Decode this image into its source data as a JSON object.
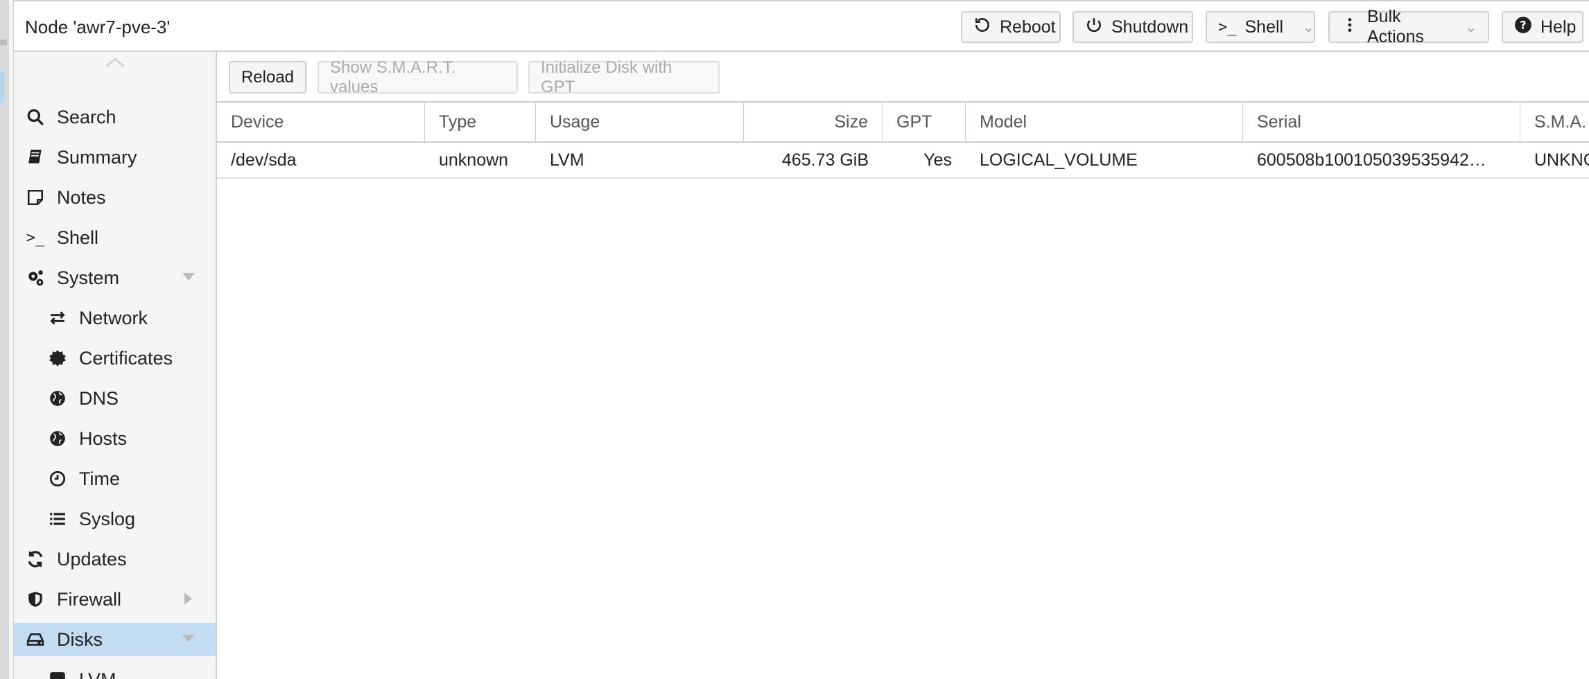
{
  "header": {
    "title": "Node 'awr7-pve-3'",
    "buttons": {
      "reboot": "Reboot",
      "shutdown": "Shutdown",
      "shell": "Shell",
      "bulk_actions": "Bulk Actions",
      "help": "Help"
    }
  },
  "sidebar": {
    "items": [
      {
        "label": "Search",
        "icon": "search-icon"
      },
      {
        "label": "Summary",
        "icon": "book-icon"
      },
      {
        "label": "Notes",
        "icon": "note-icon"
      },
      {
        "label": "Shell",
        "icon": "terminal-icon"
      },
      {
        "label": "System",
        "icon": "gears-icon"
      },
      {
        "label": "Network",
        "icon": "exchange-icon"
      },
      {
        "label": "Certificates",
        "icon": "certificate-icon"
      },
      {
        "label": "DNS",
        "icon": "globe-icon"
      },
      {
        "label": "Hosts",
        "icon": "globe-icon"
      },
      {
        "label": "Time",
        "icon": "clock-icon"
      },
      {
        "label": "Syslog",
        "icon": "list-icon"
      },
      {
        "label": "Updates",
        "icon": "refresh-icon"
      },
      {
        "label": "Firewall",
        "icon": "shield-icon"
      },
      {
        "label": "Disks",
        "icon": "hdd-icon"
      },
      {
        "label": "LVM",
        "icon": "square-icon"
      }
    ]
  },
  "toolbar": {
    "reload": "Reload",
    "smart": "Show S.M.A.R.T. values",
    "init_gpt": "Initialize Disk with GPT"
  },
  "grid": {
    "columns": [
      "Device",
      "Type",
      "Usage",
      "Size",
      "GPT",
      "Model",
      "Serial",
      "S.M.A."
    ],
    "rows": [
      {
        "device": "/dev/sda",
        "type": "unknown",
        "usage": "LVM",
        "size": "465.73 GiB",
        "gpt": "Yes",
        "model": "LOGICAL_VOLUME",
        "serial": "600508b100105039535942…",
        "smart": "UNKNOWN"
      }
    ]
  },
  "colors": {
    "selected": "#c3dcf1",
    "border": "#cfcfcf",
    "sidebar_bg": "#f5f5f5"
  }
}
